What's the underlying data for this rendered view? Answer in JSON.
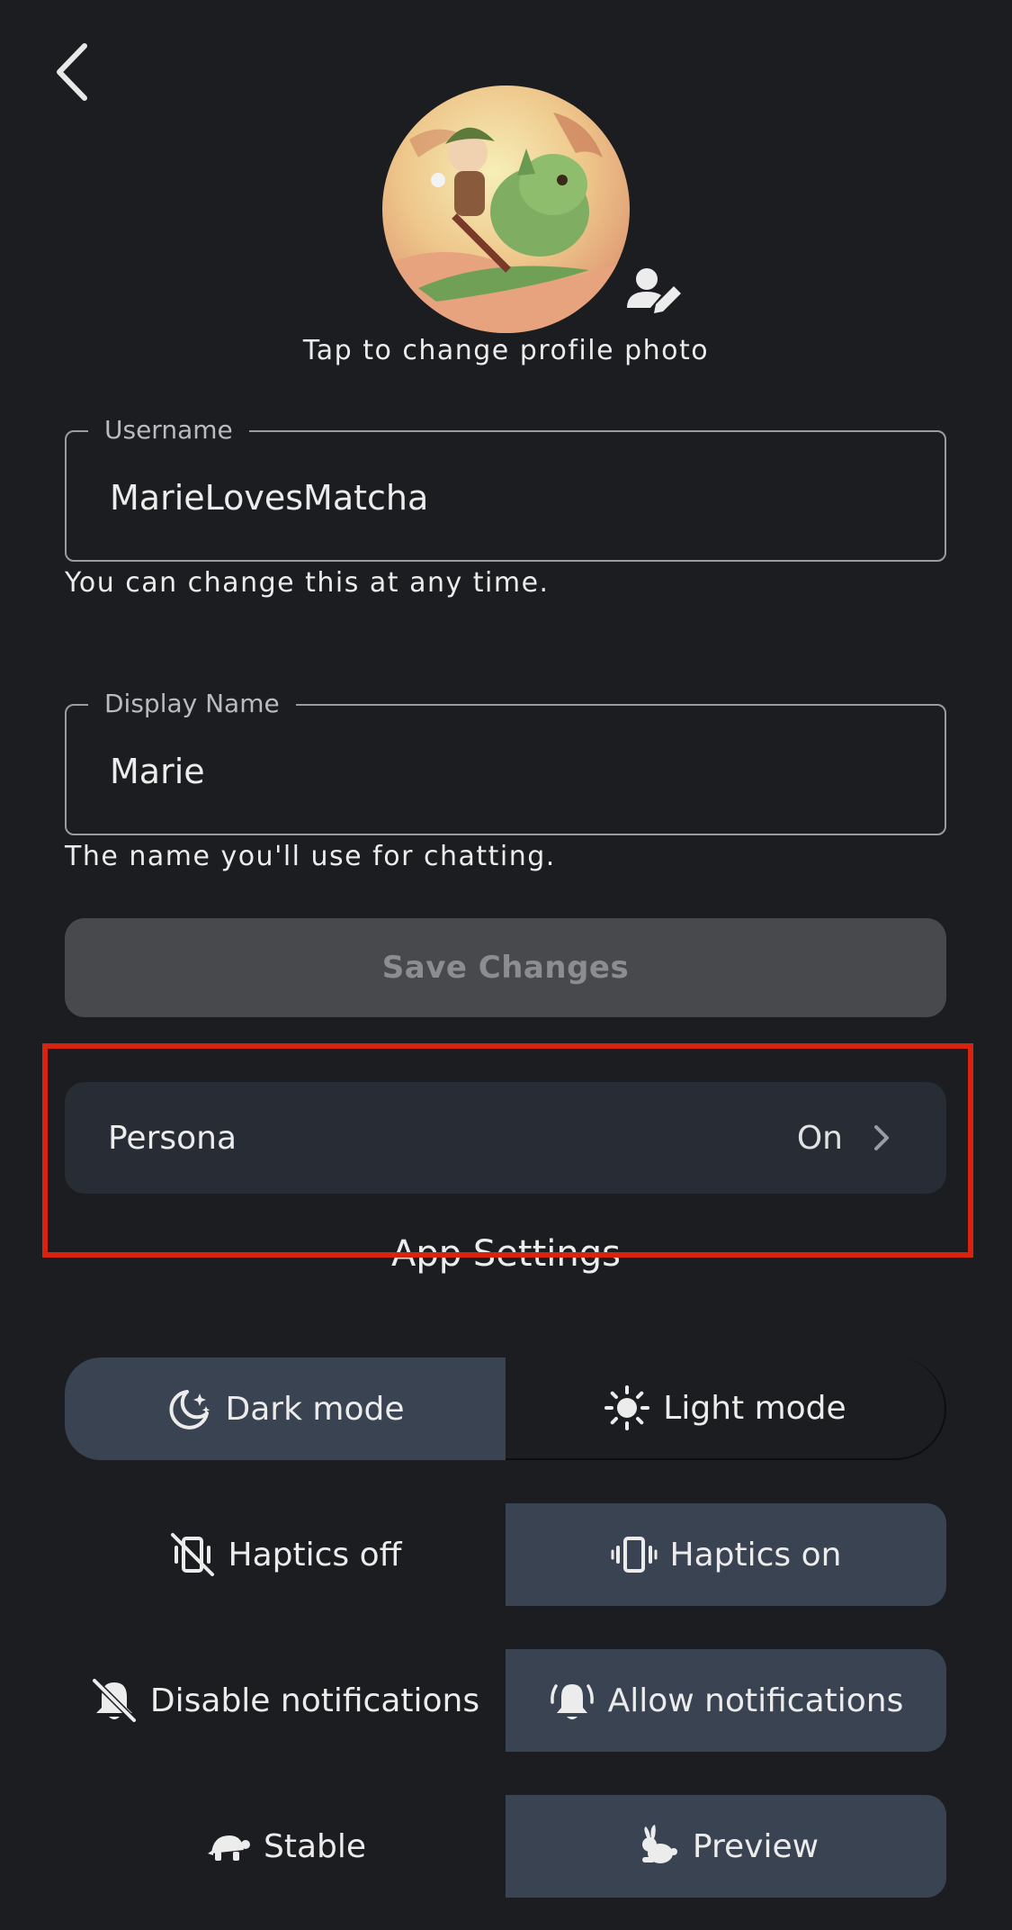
{
  "header": {
    "back_icon": "chevron-left-icon"
  },
  "profile": {
    "avatar_alt": "profile photo",
    "edit_icon": "person-edit-icon",
    "photo_hint": "Tap to change profile photo"
  },
  "username": {
    "label": "Username",
    "value": "MarieLovesMatcha",
    "helper": "You can change this at any time."
  },
  "display_name": {
    "label": "Display Name",
    "value": "Marie",
    "helper": "The name you'll use for chatting."
  },
  "save_button": {
    "label": "Save Changes"
  },
  "persona": {
    "label": "Persona",
    "value": "On",
    "chevron_icon": "chevron-right-icon"
  },
  "app_settings": {
    "title": "App Settings",
    "theme": {
      "left_label": "Dark mode",
      "left_icon": "moon-stars-icon",
      "right_label": "Light mode",
      "right_icon": "sun-icon",
      "selected": "left"
    },
    "haptics": {
      "left_label": "Haptics off",
      "left_icon": "vibration-off-icon",
      "right_label": "Haptics on",
      "right_icon": "vibration-icon",
      "selected": "right"
    },
    "notifications": {
      "left_label": "Disable notifications",
      "left_icon": "bell-off-icon",
      "right_label": "Allow notifications",
      "right_icon": "bell-ring-icon",
      "selected": "right"
    },
    "channel": {
      "left_label": "Stable",
      "left_icon": "turtle-icon",
      "right_label": "Preview",
      "right_icon": "rabbit-icon",
      "selected": "right"
    }
  },
  "colors": {
    "background": "#1c1d20",
    "selected_option": "#3a4352",
    "persona_row": "#272c35",
    "save_disabled": "#48494c",
    "highlight": "#d8240e"
  }
}
